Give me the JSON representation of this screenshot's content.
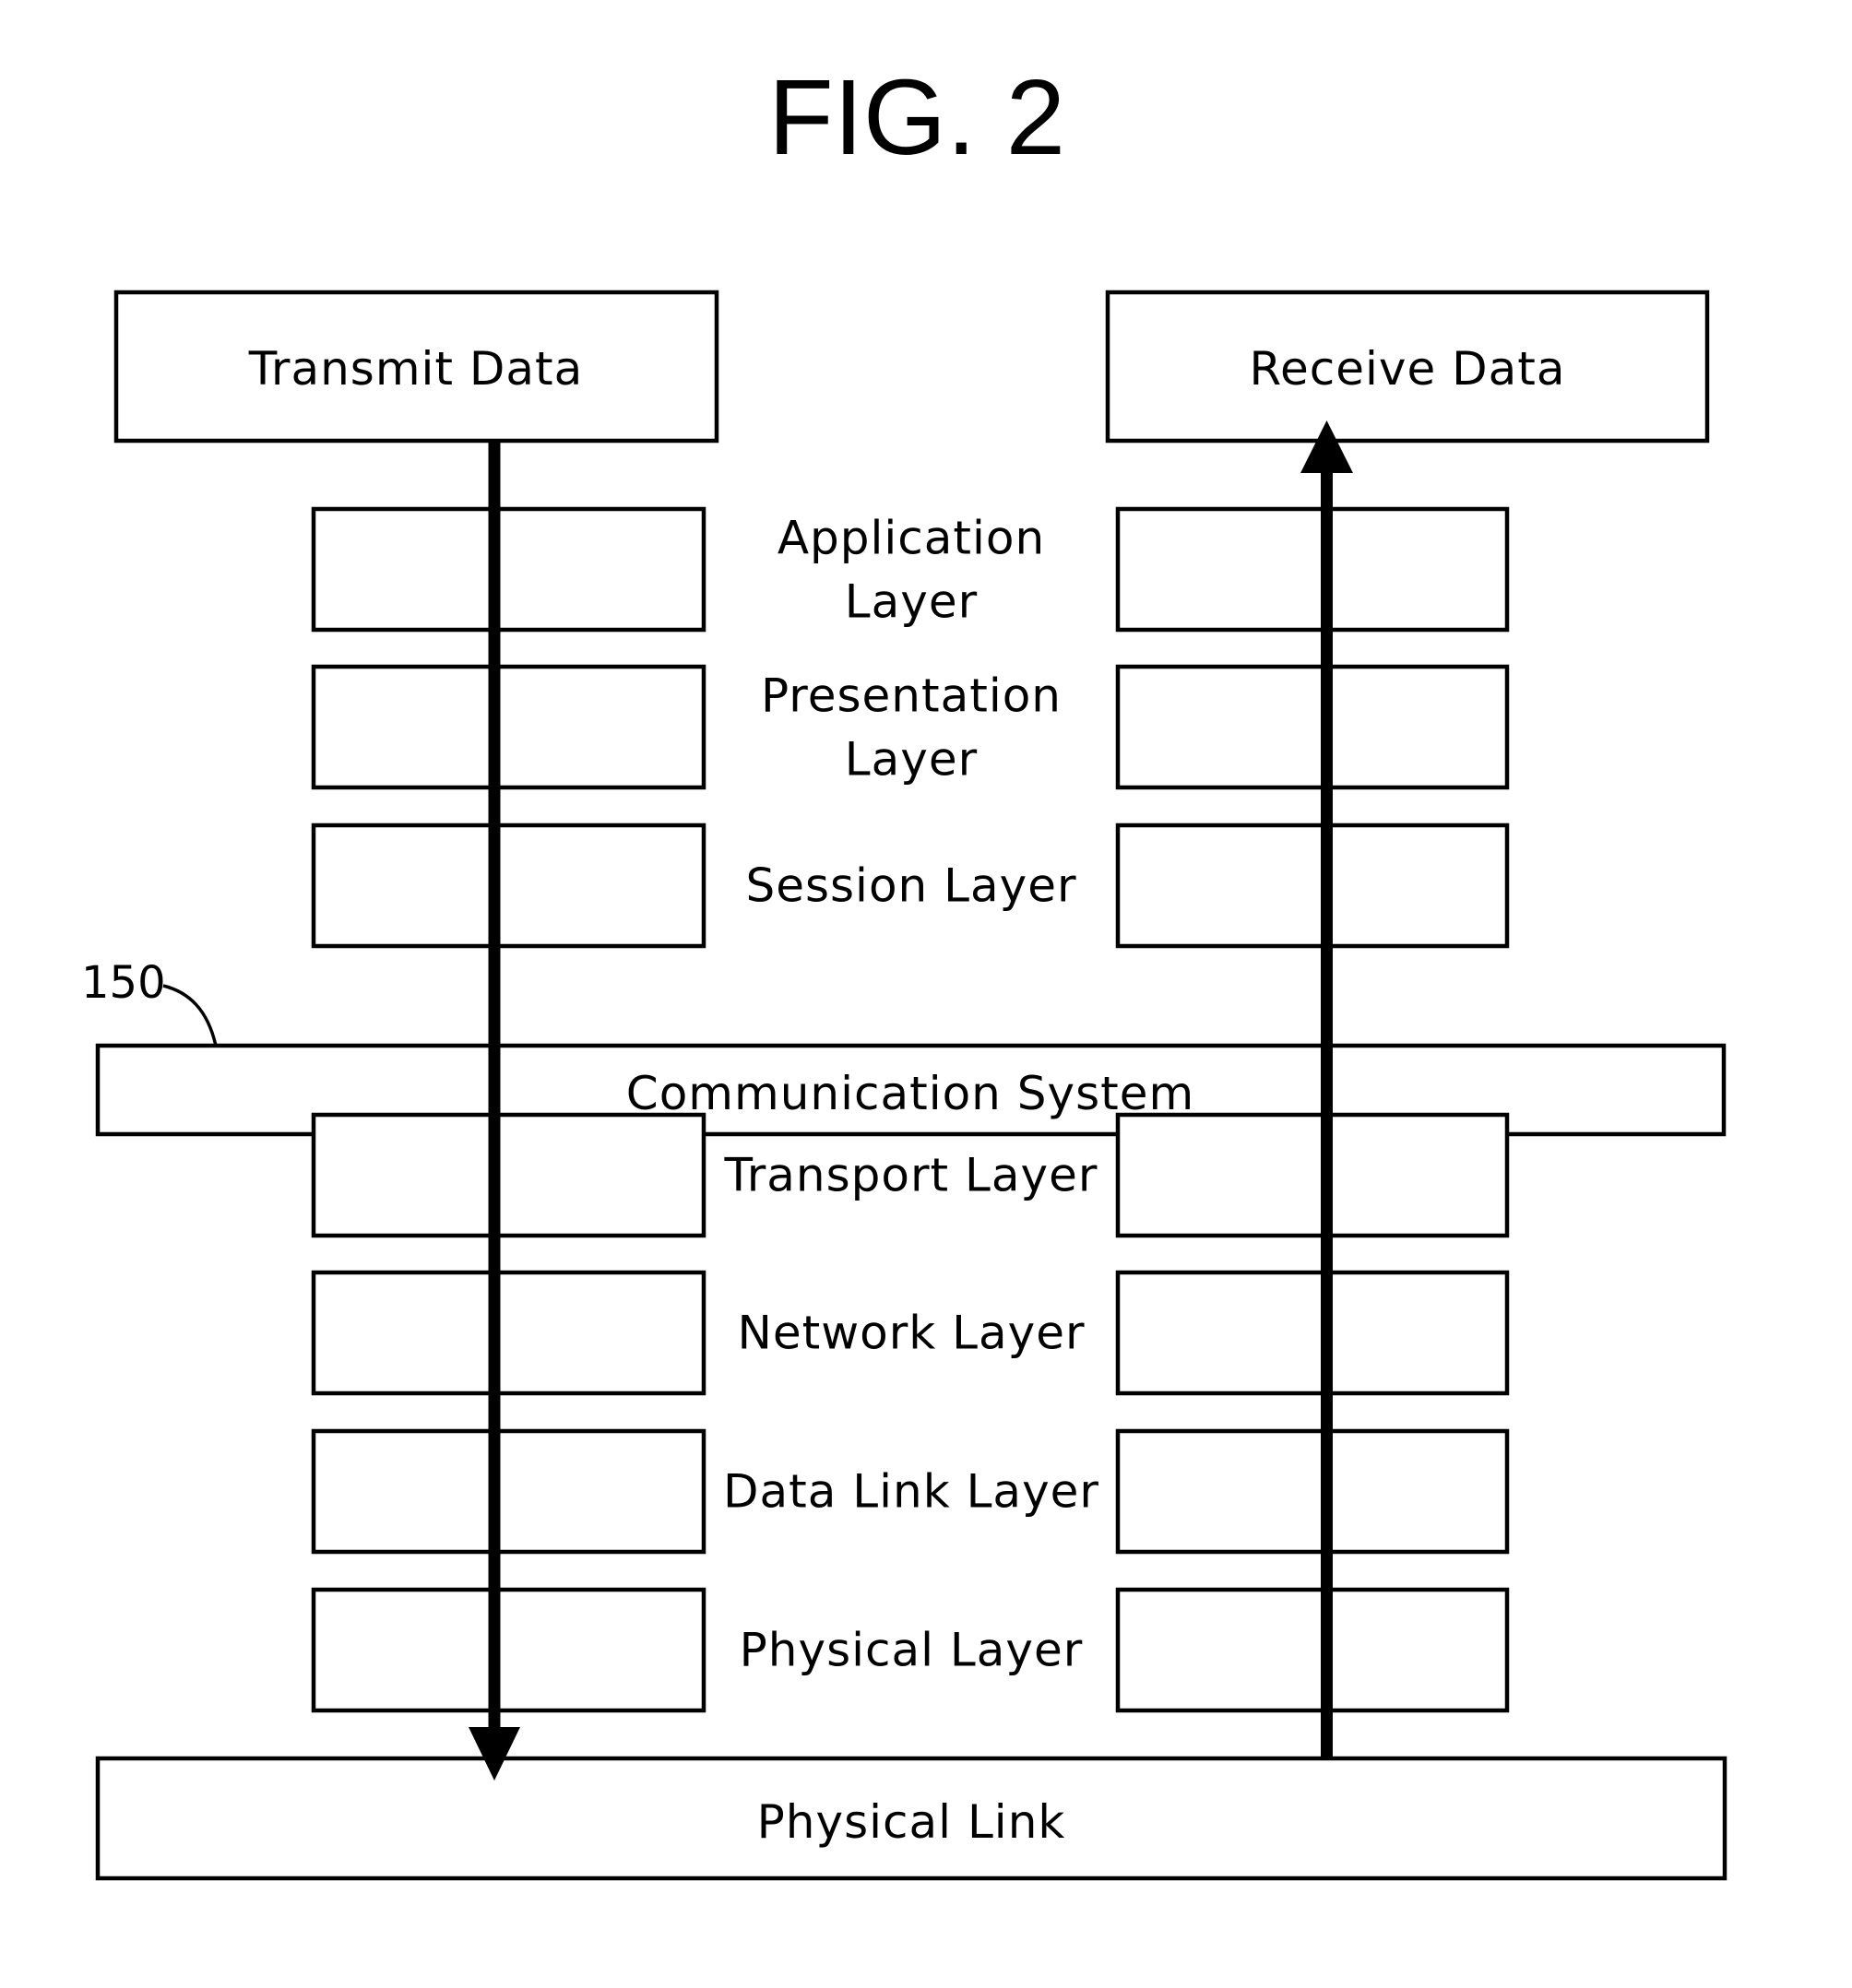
{
  "figure": {
    "title": "FIG. 2",
    "transmit_label": "Transmit Data",
    "receive_label": "Receive Data",
    "communication_system": {
      "label": "Communication System",
      "reference_numeral": "150"
    },
    "physical_link_label": "Physical Link",
    "layers": [
      {
        "name": "application",
        "lines": [
          "Application",
          "Layer"
        ]
      },
      {
        "name": "presentation",
        "lines": [
          "Presentation",
          "Layer"
        ]
      },
      {
        "name": "session",
        "lines": [
          "Session Layer"
        ]
      },
      {
        "name": "transport",
        "lines": [
          "Transport Layer"
        ]
      },
      {
        "name": "network",
        "lines": [
          "Network Layer"
        ]
      },
      {
        "name": "data-link",
        "lines": [
          "Data Link Layer"
        ]
      },
      {
        "name": "physical",
        "lines": [
          "Physical Layer"
        ]
      }
    ],
    "flows": [
      {
        "name": "transmit-flow",
        "direction": "down",
        "from": "Transmit Data",
        "to": "Physical Link"
      },
      {
        "name": "receive-flow",
        "direction": "up",
        "from": "Physical Link",
        "to": "Receive Data"
      }
    ]
  }
}
